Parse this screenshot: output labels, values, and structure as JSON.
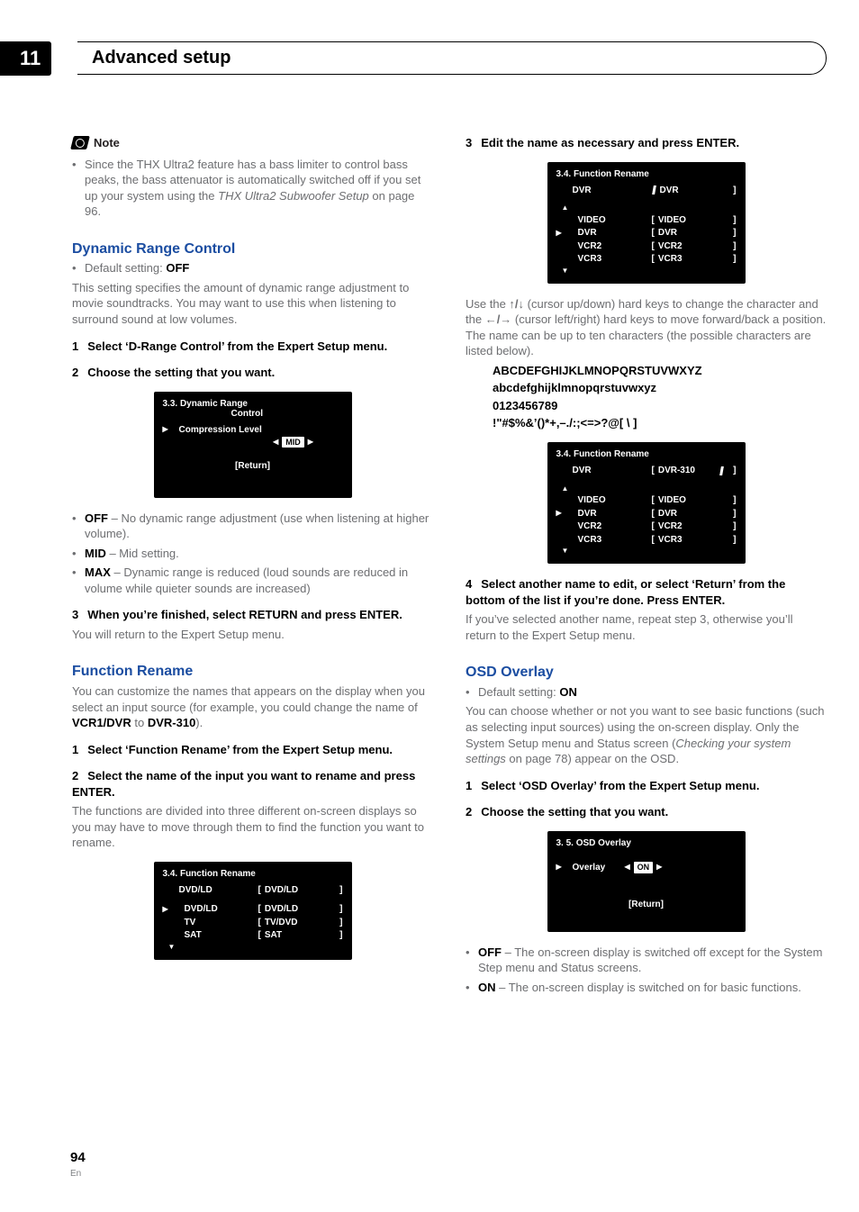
{
  "pageNumberTop": "11",
  "chapterTitle": "Advanced setup",
  "note": {
    "label": "Note",
    "bullet": "Since the THX Ultra2 feature has a bass limiter to control bass peaks, the bass attenuator is automatically switched off if you set up your system using the ",
    "bulletItalic": "THX Ultra2 Subwoofer Setup",
    "bulletTail": " on page 96."
  },
  "drc": {
    "heading": "Dynamic Range Control",
    "defaultLabel": "Default setting: ",
    "defaultValue": "OFF",
    "intro": "This setting specifies the amount of dynamic range adjustment to movie soundtracks. You may want to use this when listening to surround sound at low volumes.",
    "step1": "Select ‘D-Range Control’ from the Expert Setup menu.",
    "step2": "Choose the setting that you want.",
    "osd": {
      "title1": "3.3. Dynamic  Range",
      "title2": "Control",
      "row_label": "Compression Level",
      "row_value": "MID",
      "return": "[Return]"
    },
    "opts": [
      {
        "name": "OFF",
        "desc": " – No dynamic range adjustment (use when listening at higher volume)."
      },
      {
        "name": "MID",
        "desc": " – Mid setting."
      },
      {
        "name": "MAX",
        "desc": " – Dynamic range is reduced (loud sounds are reduced in volume while quieter sounds are increased)"
      }
    ],
    "step3": "When you’re finished, select RETURN and press ENTER.",
    "step3body": "You will return to the Expert Setup menu."
  },
  "fr": {
    "heading": "Function Rename",
    "intro1": "You can customize the names that appears on the display when you select an input source (for example, you could change the name of ",
    "intro_b1": "VCR1/DVR",
    "intro_mid": " to ",
    "intro_b2": "DVR-310",
    "intro_end": ").",
    "step1": "Select ‘Function Rename’ from the Expert Setup menu.",
    "step2": "Select the name of the input you want to rename and press ENTER.",
    "step2body": "The functions are divided into three different on-screen displays so you may have to move through them to find the function you want to rename.",
    "osd1": {
      "title": "3.4. Function  Rename",
      "head_l": "DVD/LD",
      "head_r": "DVD/LD",
      "rows": [
        {
          "l": "DVD/LD",
          "r": "DVD/LD",
          "sel": true
        },
        {
          "l": "TV",
          "r": "TV/DVD",
          "sel": false
        },
        {
          "l": "SAT",
          "r": "SAT",
          "sel": false
        }
      ]
    }
  },
  "right": {
    "step3": "Edit the name as necessary and press ENTER.",
    "osd2": {
      "title": "3.4. Function  Rename",
      "head_l": "DVR",
      "head_r": "DVR",
      "rows": [
        {
          "l": "VIDEO",
          "r": "VIDEO",
          "sel": false
        },
        {
          "l": "DVR",
          "r": "DVR",
          "sel": true
        },
        {
          "l": "VCR2",
          "r": "VCR2",
          "sel": false
        },
        {
          "l": "VCR3",
          "r": "VCR3",
          "sel": false
        }
      ]
    },
    "cursor_body1": "Use the ",
    "cursor_sym1": "↑/↓",
    "cursor_body2": " (cursor up/down) hard keys to change the character and the ",
    "cursor_sym2": "←/→",
    "cursor_body3": " (cursor left/right) hard keys to move forward/back a position. The name can be up to ten characters (the possible characters are listed below).",
    "chars": [
      "ABCDEFGHIJKLMNOPQRSTUVWXYZ",
      "abcdefghijklmnopqrstuvwxyz",
      "0123456789",
      "!\"#$%&’()*+,–./:;<=>?@[ \\ ]"
    ],
    "osd3": {
      "title": "3.4. Function  Rename",
      "head_l": "DVR",
      "head_r": "DVR-310",
      "rows": [
        {
          "l": "VIDEO",
          "r": "VIDEO",
          "sel": false
        },
        {
          "l": "DVR",
          "r": "DVR",
          "sel": true
        },
        {
          "l": "VCR2",
          "r": "VCR2",
          "sel": false
        },
        {
          "l": "VCR3",
          "r": "VCR3",
          "sel": false
        }
      ]
    },
    "step4": "Select another name to edit, or select ‘Return’ from the bottom of the list if you’re done. Press ENTER.",
    "step4body": "If you’ve selected another name, repeat step 3, otherwise you’ll return to the Expert Setup menu."
  },
  "osdov": {
    "heading": "OSD Overlay",
    "defaultLabel": "Default setting: ",
    "defaultValue": "ON",
    "intro1": "You can choose whether or not you want to see basic functions (such as selecting input sources) using the on-screen display. Only the System Setup menu and Status screen (",
    "introItalic": "Checking your system settings",
    "intro2": " on page 78) appear on the OSD.",
    "step1": "Select ‘OSD Overlay’ from the Expert Setup menu.",
    "step2": "Choose the setting that you want.",
    "osd": {
      "title": "3. 5. OSD Overlay",
      "row_label": "Overlay",
      "row_value": "ON",
      "return": "[Return]"
    },
    "opts": [
      {
        "name": "OFF",
        "desc": " – The on-screen display is switched off except for the System Step menu and Status screens."
      },
      {
        "name": "ON",
        "desc": " – The on-screen display is switched on for basic functions."
      }
    ]
  },
  "footer": {
    "page": "94",
    "lang": "En"
  }
}
